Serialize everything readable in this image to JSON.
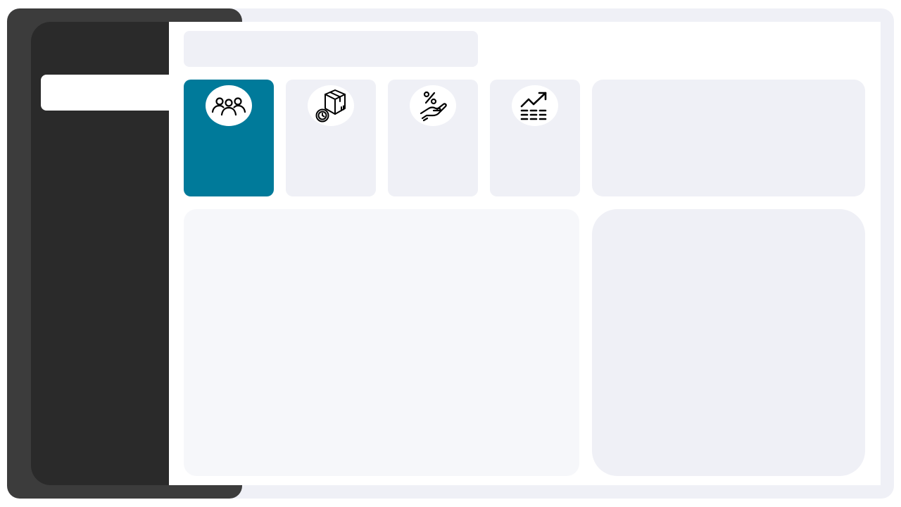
{
  "colors": {
    "frame": "#eff0f6",
    "sidebar_shell": "#3c3c3c",
    "sidebar": "#2a2a2a",
    "accent": "#007a9a",
    "card": "#eff0f6",
    "panel": "#f6f7fa"
  },
  "sidebar": {
    "active_item_label": ""
  },
  "search": {
    "placeholder": ""
  },
  "stat_cards": [
    {
      "icon": "users-group-icon",
      "label": "",
      "value": "",
      "active": true
    },
    {
      "icon": "package-clock-icon",
      "label": "",
      "value": "",
      "active": false
    },
    {
      "icon": "discount-hand-icon",
      "label": "",
      "value": "",
      "active": false
    },
    {
      "icon": "trend-chart-icon",
      "label": "",
      "value": "",
      "active": false
    }
  ]
}
